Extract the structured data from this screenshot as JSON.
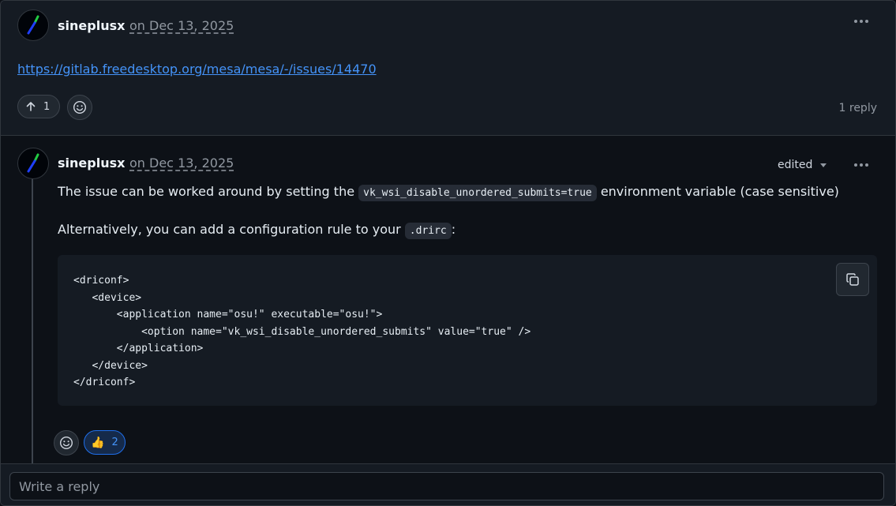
{
  "top_comment": {
    "author": "sineplusx",
    "date": "on Dec 13, 2025",
    "link_text": "https://gitlab.freedesktop.org/mesa/mesa/-/issues/14470",
    "upvote_count": "1",
    "reply_count": "1 reply"
  },
  "reply": {
    "author": "sineplusx",
    "date": "on Dec 13, 2025",
    "edited_label": "edited",
    "para1_before": "The issue can be worked around by setting the ",
    "para1_code": "vk_wsi_disable_unordered_submits=true",
    "para1_after": " environment variable (case sensitive)",
    "para2_before": "Alternatively, you can add a configuration rule to your ",
    "para2_code": ".drirc",
    "para2_after": ":",
    "code_lines": [
      "<driconf>",
      "   <device>",
      "       <application name=\"osu!\" executable=\"osu!\">",
      "           <option name=\"vk_wsi_disable_unordered_submits\" value=\"true\" />",
      "       </application>",
      "   </device>",
      "</driconf>"
    ],
    "reaction_emoji": "👍",
    "reaction_count": "2"
  },
  "reply_box": {
    "placeholder": "Write a reply"
  },
  "icons": {
    "kebab": "kebab-horizontal-icon",
    "upvote": "arrow-up-icon",
    "emoji": "smiley-icon",
    "copy": "copy-icon",
    "caret": "triangle-down-icon"
  },
  "colors": {
    "background": "#0d1117",
    "panel": "#151b23",
    "border": "#30363d",
    "link": "#4493f8",
    "muted": "#9198a1",
    "reaction_active_border": "#1f6feb"
  }
}
